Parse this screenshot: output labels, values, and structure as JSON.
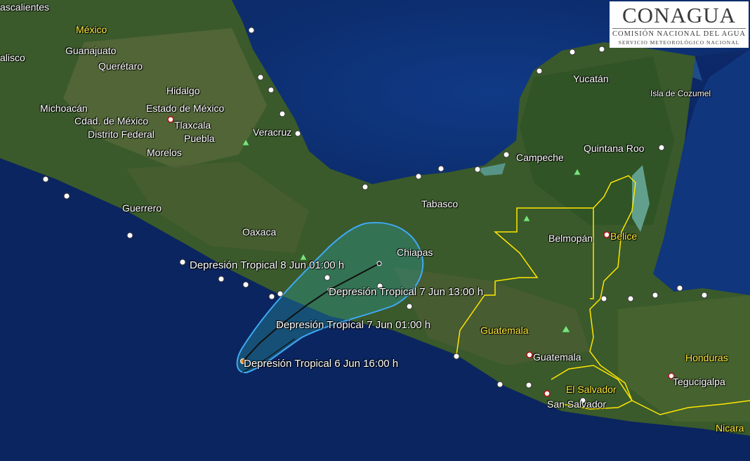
{
  "logo": {
    "name": "CONAGUA",
    "line1": "COMISIÓN NACIONAL DEL AGUA",
    "line2": "SERVICIO METEOROLÓGICO NACIONAL"
  },
  "labels": {
    "aguascalientes": "ascalientes",
    "mexico": "México",
    "guanajuato": "Guanajuato",
    "jalisco": "alisco",
    "queretaro": "Querétaro",
    "hidalgo": "Hidalgo",
    "michoacan": "Michoacán",
    "edomex": "Estado de México",
    "cdmx": "Cdad. de México",
    "tlaxcala": "Tlaxcala",
    "df": "Distrito Federal",
    "puebla": "Puebla",
    "veracruz": "Veracruz",
    "morelos": "Morelos",
    "guerrero": "Guerrero",
    "oaxaca": "Oaxaca",
    "tabasco": "Tabasco",
    "chiapas": "Chiapas",
    "yucatan": "Yucatán",
    "cozumel": "Isla de Cozumel",
    "campeche": "Campeche",
    "quintana_roo": "Quintana Roo",
    "belmopan": "Belmopán",
    "belice": "Belice",
    "guatemala_country": "Guatemala",
    "guatemala_city": "Guatemala",
    "el_salvador": "El Salvador",
    "san_salvador": "San Salvador",
    "honduras": "Honduras",
    "tegucigalpa": "Tegucigalpa",
    "nicaragua": "Nicara"
  },
  "track": {
    "p1": "Depresión Tropical 8 Jun 01:00 h",
    "p2": "Depresión Tropical 7 Jun 13:00 h",
    "p3": "Depresión Tropical 7 Jun 01:00 h",
    "p4": "Depresión Tropical 6 Jun 16:00 h"
  },
  "colors": {
    "ocean_deep": "#0d2a6b",
    "ocean_shelf": "#1f4f9a",
    "land": "#3b5a2a",
    "cone_fill": "#2aa0a0",
    "cone_stroke": "#3fa9f5",
    "border": "#ffe600"
  }
}
